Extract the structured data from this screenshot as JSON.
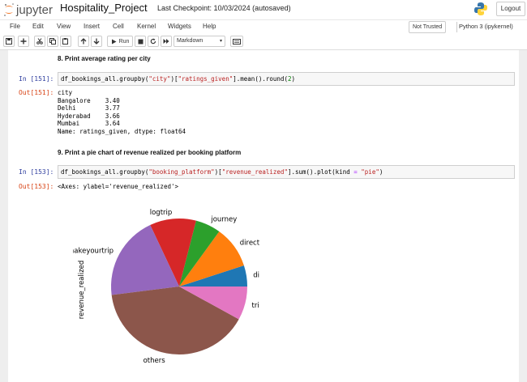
{
  "header": {
    "logo_text": "jupyter",
    "notebook_title": "Hospitality_Project",
    "checkpoint": "Last Checkpoint: 10/03/2024  (autosaved)",
    "logout_label": "Logout"
  },
  "menubar": {
    "items": [
      "File",
      "Edit",
      "View",
      "Insert",
      "Cell",
      "Kernel",
      "Widgets",
      "Help"
    ],
    "trusted_label": "Not Trusted",
    "kernel_label": "Python 3 (ipykernel)"
  },
  "toolbar": {
    "run_label": "Run",
    "cell_type": "Markdown"
  },
  "cells": {
    "heading8": "8. Print average rating per city",
    "in151_prompt": "In [151]:",
    "in151_code_pre": "df_bookings_all.groupby(",
    "in151_s1": "\"city\"",
    "in151_mid": ")[",
    "in151_s2": "\"ratings_given\"",
    "in151_post": "].mean().round(",
    "in151_num": "2",
    "in151_end": ")",
    "out151_prompt": "Out[151]:",
    "out151_lines": [
      "city",
      "Bangalore    3.40",
      "Delhi        3.77",
      "Hyderabad    3.66",
      "Mumbai       3.64",
      "Name: ratings_given, dtype: float64"
    ],
    "heading9": "9. Print a pie chart of revenue realized per booking platform",
    "in153_prompt": "In [153]:",
    "in153_code_pre": "df_bookings_all.groupby(",
    "in153_s1": "\"booking_platform\"",
    "in153_mid": ")[",
    "in153_s2": "\"revenue_realized\"",
    "in153_post": "].sum().plot(kind ",
    "in153_op": "=",
    "in153_space": " ",
    "in153_s3": "\"pie\"",
    "in153_end": ")",
    "out153_prompt": "Out[153]:",
    "out153_text": "<Axes: ylabel='revenue_realized'>"
  },
  "chart_data": {
    "type": "pie",
    "ylabel": "revenue_realized",
    "slices": [
      {
        "label": "direct offline",
        "fraction": 0.05,
        "color": "#1f77b4"
      },
      {
        "label": "direct online",
        "fraction": 0.1,
        "color": "#ff7f0e"
      },
      {
        "label": "journey",
        "fraction": 0.06,
        "color": "#2ca02c"
      },
      {
        "label": "logtrip",
        "fraction": 0.11,
        "color": "#d62728"
      },
      {
        "label": "makeyourtrip",
        "fraction": 0.2,
        "color": "#9467bd"
      },
      {
        "label": "others",
        "fraction": 0.4,
        "color": "#8c564b"
      },
      {
        "label": "tripster",
        "fraction": 0.08,
        "color": "#e377c2"
      }
    ],
    "start_angle_deg": 0,
    "direction": "counterclockwise"
  }
}
